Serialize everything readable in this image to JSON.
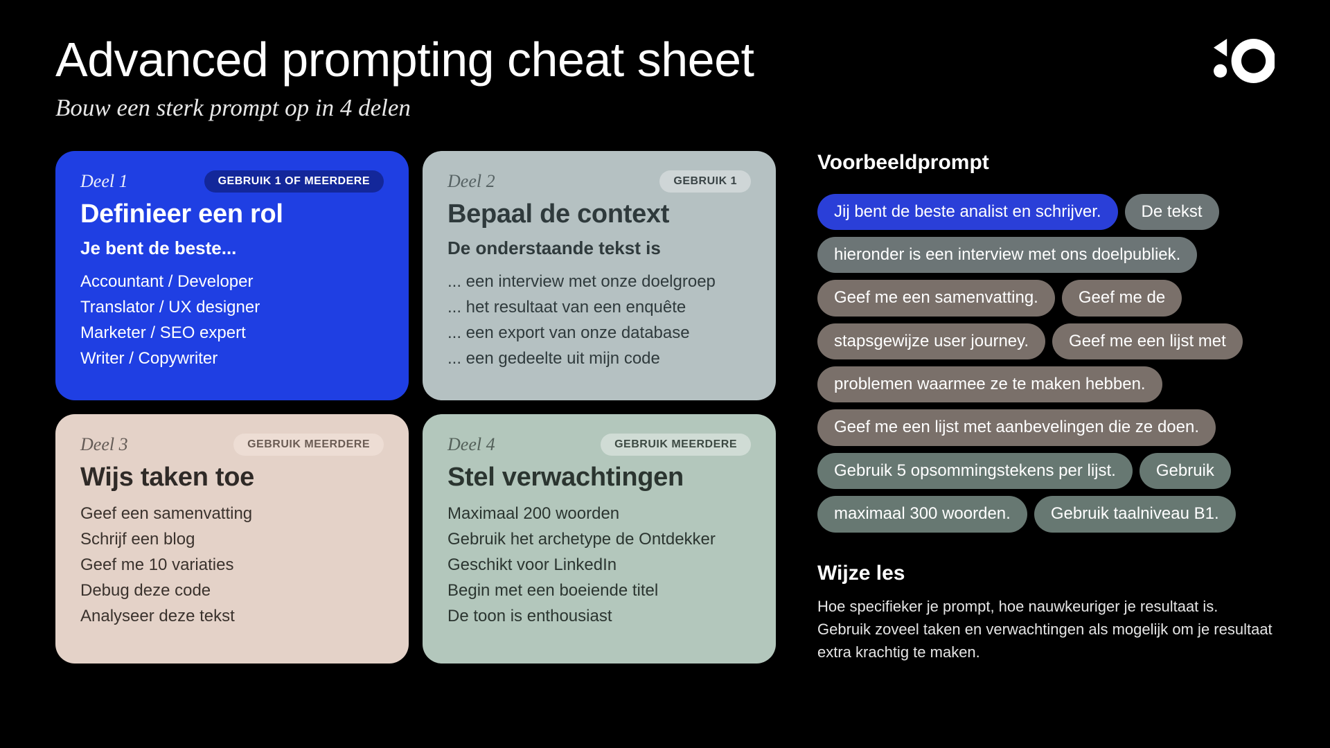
{
  "header": {
    "title": "Advanced prompting cheat sheet",
    "subtitle": "Bouw een sterk prompt op in 4 delen"
  },
  "cards": {
    "c1": {
      "deel": "Deel 1",
      "pill": "GEBRUIK 1 OF MEERDERE",
      "heading": "Definieer een rol",
      "intro": "Je bent de beste...",
      "lines": [
        "Accountant  /  Developer",
        "Translator  /  UX designer",
        "Marketer  /  SEO expert",
        "Writer  /  Copywriter"
      ]
    },
    "c2": {
      "deel": "Deel 2",
      "pill": "GEBRUIK 1",
      "heading": "Bepaal de context",
      "intro": "De onderstaande tekst is",
      "lines": [
        "... een interview met onze doelgroep",
        "... het resultaat van een enquête",
        "... een export van onze database",
        "... een gedeelte uit mijn code"
      ]
    },
    "c3": {
      "deel": "Deel 3",
      "pill": "GEBRUIK MEERDERE",
      "heading": "Wijs taken toe",
      "intro": "",
      "lines": [
        "Geef een samenvatting",
        "Schrijf een blog",
        "Geef me 10 variaties",
        "Debug deze code",
        "Analyseer deze tekst"
      ]
    },
    "c4": {
      "deel": "Deel 4",
      "pill": "GEBRUIK MEERDERE",
      "heading": "Stel verwachtingen",
      "intro": "",
      "lines": [
        "Maximaal 200 woorden",
        "Gebruik het archetype de Ontdekker",
        "Geschikt voor LinkedIn",
        "Begin met een boeiende titel",
        "De toon is enthousiast"
      ]
    }
  },
  "example": {
    "title": "Voorbeeldprompt",
    "chips": [
      {
        "text": "Jij bent de beste analist en schrijver.",
        "variant": "blue"
      },
      {
        "text": "De tekst",
        "variant": "gray"
      },
      {
        "text": "hieronder is een interview met ons doelpubliek.",
        "variant": "gray"
      },
      {
        "text": "Geef me een samenvatting.",
        "variant": "taupe"
      },
      {
        "text": "Geef me de",
        "variant": "taupe"
      },
      {
        "text": "stapsgewijze user journey.",
        "variant": "taupe"
      },
      {
        "text": "Geef me een lijst met",
        "variant": "taupe"
      },
      {
        "text": "problemen waarmee ze te maken hebben.",
        "variant": "taupe"
      },
      {
        "text": "Geef me een lijst met aanbevelingen die ze doen.",
        "variant": "taupe"
      },
      {
        "text": "Gebruik 5 opsommingstekens per lijst.",
        "variant": "sage"
      },
      {
        "text": "Gebruik",
        "variant": "sage"
      },
      {
        "text": "maximaal 300 woorden.",
        "variant": "sage"
      },
      {
        "text": "Gebruik taalniveau B1.",
        "variant": "sage"
      }
    ]
  },
  "lesson": {
    "title": "Wijze les",
    "body": "Hoe specifieker je prompt, hoe nauwkeuriger je resultaat is. Gebruik zoveel taken en verwachtingen als mogelijk om je resultaat extra krachtig te maken."
  }
}
